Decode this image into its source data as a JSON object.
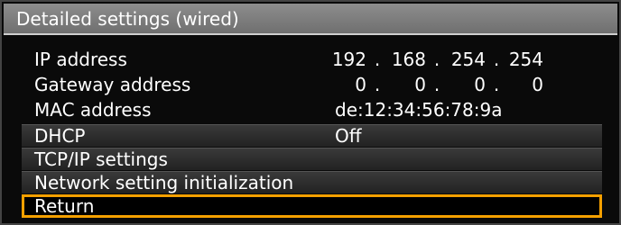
{
  "title": "Detailed settings (wired)",
  "info": {
    "ip_address": {
      "label": "IP address",
      "octets": [
        "192",
        "168",
        "254",
        "254"
      ],
      "sep": "."
    },
    "gateway_address": {
      "label": "Gateway address",
      "octets": [
        "0",
        "0",
        "0",
        "0"
      ],
      "sep": "."
    },
    "mac_address": {
      "label": "MAC address",
      "value": "de:12:34:56:78:9a"
    }
  },
  "menu": {
    "dhcp": {
      "label": "DHCP",
      "value": "Off"
    },
    "tcpip": {
      "label": "TCP/IP settings"
    },
    "init": {
      "label": "Network setting initialization"
    },
    "return": {
      "label": "Return"
    }
  },
  "colors": {
    "selection_border": "#f4a000",
    "title_bar": "#7f7f7f",
    "background": "#0a0a0a"
  }
}
